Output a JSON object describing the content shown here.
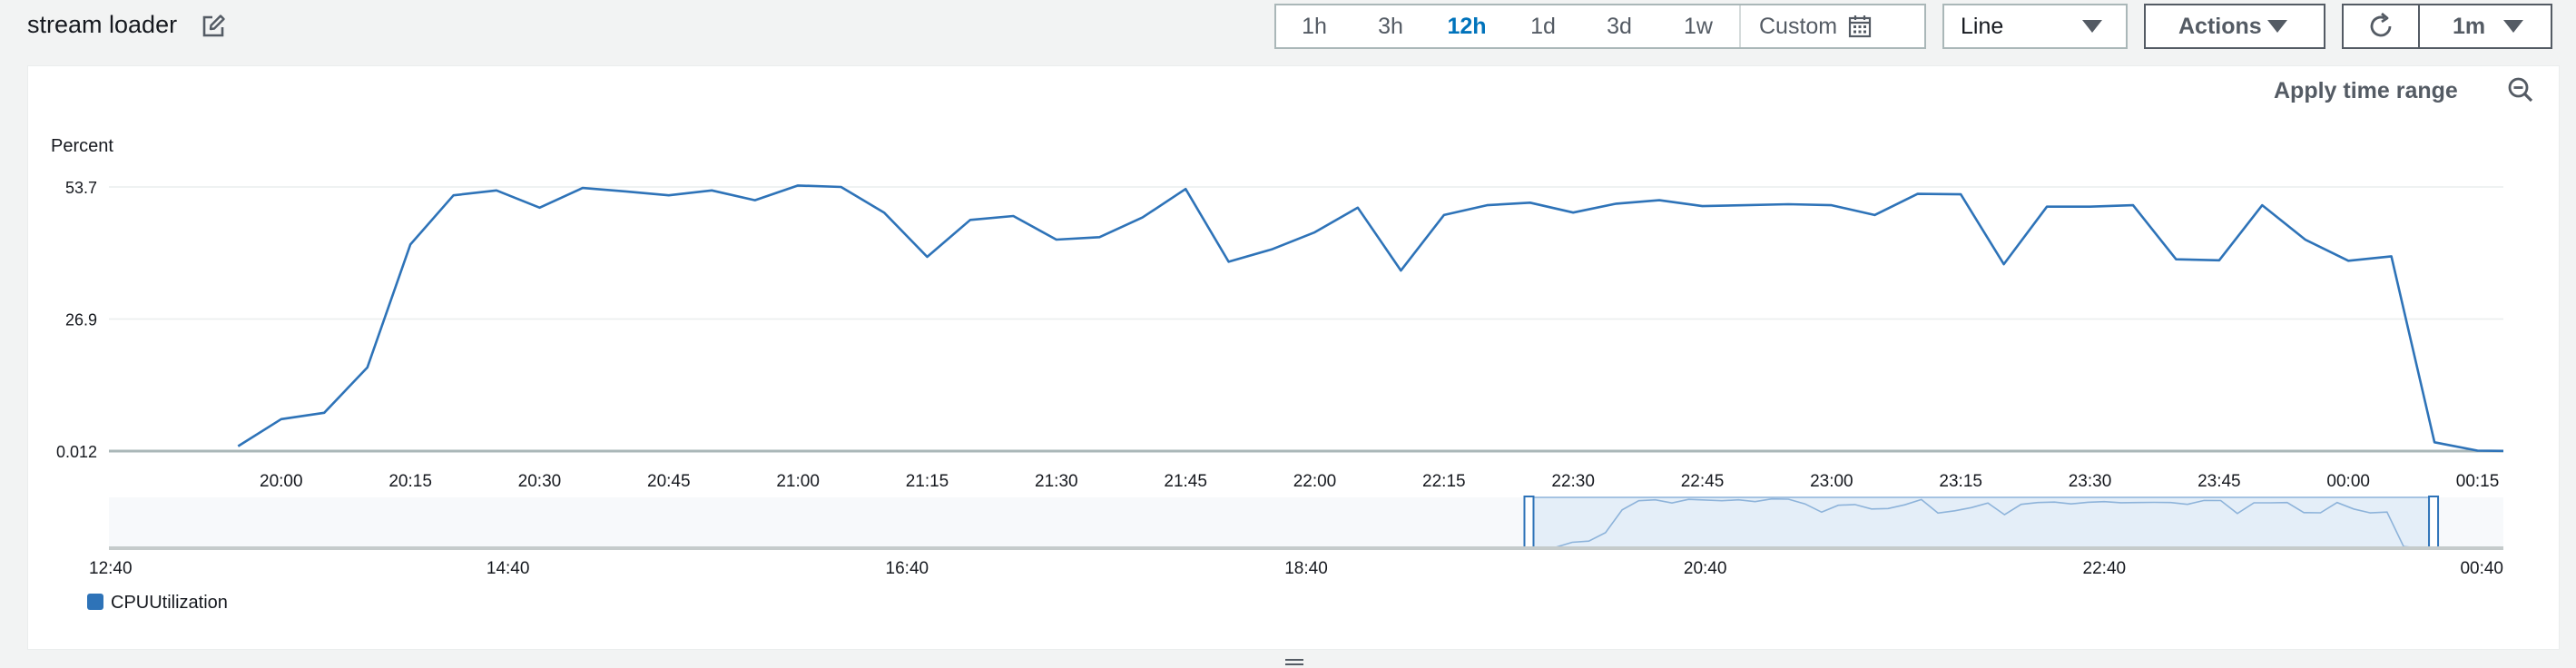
{
  "header": {
    "title": "stream loader"
  },
  "time_ranges": [
    {
      "label": "1h",
      "active": false
    },
    {
      "label": "3h",
      "active": false
    },
    {
      "label": "12h",
      "active": true
    },
    {
      "label": "1d",
      "active": false
    },
    {
      "label": "3d",
      "active": false
    },
    {
      "label": "1w",
      "active": false
    }
  ],
  "custom_label": "Custom",
  "chart_type_select": {
    "value": "Line"
  },
  "actions_label": "Actions",
  "refresh_interval": "1m",
  "apply_time_range_label": "Apply time range",
  "colors": {
    "series": "#2e73b8",
    "active": "#0073bb",
    "grid": "#eaeded"
  },
  "chart_data": {
    "type": "line",
    "ylabel": "Percent",
    "y_ticks": [
      "53.7",
      "26.9",
      "0.012"
    ],
    "ylim": [
      0.012,
      53.7
    ],
    "x_ticks": [
      "20:00",
      "20:15",
      "20:30",
      "20:45",
      "21:00",
      "21:15",
      "21:30",
      "21:45",
      "22:00",
      "22:15",
      "22:30",
      "22:45",
      "23:00",
      "23:15",
      "23:30",
      "23:45",
      "00:00",
      "00:15"
    ],
    "x_tick_minutes": [
      1200,
      1215,
      1230,
      1245,
      1260,
      1275,
      1290,
      1305,
      1320,
      1335,
      1350,
      1365,
      1380,
      1395,
      1410,
      1425,
      1440,
      1455
    ],
    "xlim_minutes": [
      1180,
      1458
    ],
    "series": [
      {
        "name": "CPUUtilization",
        "x_minutes": [
          1195,
          1200,
          1205,
          1210,
          1215,
          1220,
          1225,
          1230,
          1235,
          1240,
          1245,
          1250,
          1255,
          1260,
          1265,
          1270,
          1275,
          1280,
          1285,
          1290,
          1295,
          1300,
          1305,
          1310,
          1315,
          1320,
          1325,
          1330,
          1335,
          1340,
          1345,
          1350,
          1355,
          1360,
          1365,
          1370,
          1375,
          1380,
          1385,
          1390,
          1395,
          1400,
          1405,
          1410,
          1415,
          1420,
          1425,
          1430,
          1435,
          1440,
          1445,
          1450,
          1455,
          1458
        ],
        "values": [
          1.0,
          6.5,
          7.8,
          17.0,
          42.0,
          52.0,
          53.0,
          49.5,
          53.5,
          52.8,
          52.0,
          53.0,
          51.0,
          54.0,
          53.7,
          48.5,
          39.5,
          47.0,
          47.8,
          43.0,
          43.5,
          47.5,
          53.3,
          38.5,
          41.0,
          44.5,
          49.5,
          36.7,
          48.0,
          50.0,
          50.5,
          48.5,
          50.3,
          51.0,
          49.8,
          50.0,
          50.2,
          50.0,
          48.0,
          52.3,
          52.2,
          38.0,
          49.7,
          49.7,
          50.0,
          39.0,
          38.8,
          50.0,
          43.0,
          38.7,
          39.6,
          1.8,
          0.1,
          0.05
        ]
      }
    ],
    "overview": {
      "x_ticks": [
        "12:40",
        "14:40",
        "16:40",
        "18:40",
        "20:40",
        "22:40",
        "00:40"
      ],
      "x_tick_minutes": [
        760,
        880,
        1000,
        1120,
        1240,
        1360,
        1480
      ],
      "xlim_minutes": [
        760,
        1480
      ],
      "selection_minutes": [
        1187,
        1459
      ]
    }
  }
}
